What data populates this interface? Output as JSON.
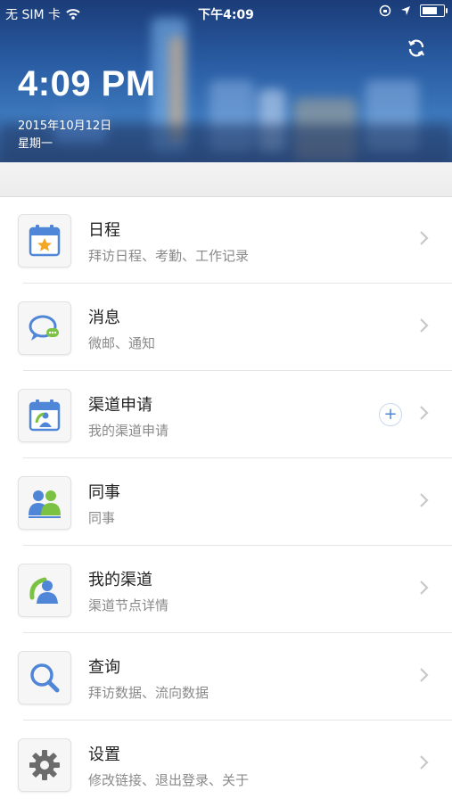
{
  "status_bar": {
    "carrier": "无 SIM 卡",
    "time": "下午4:09"
  },
  "header": {
    "clock": "4:09 PM",
    "date": "2015年10月12日",
    "weekday": "星期一"
  },
  "menu": [
    {
      "title": "日程",
      "subtitle": "拜访日程、考勤、工作记录",
      "icon": "calendar-star-icon"
    },
    {
      "title": "消息",
      "subtitle": "微邮、通知",
      "icon": "chat-bubble-icon"
    },
    {
      "title": "渠道申请",
      "subtitle": "我的渠道申请",
      "icon": "calendar-person-icon",
      "has_add": true
    },
    {
      "title": "同事",
      "subtitle": "同事",
      "icon": "colleagues-icon"
    },
    {
      "title": "我的渠道",
      "subtitle": "渠道节点详情",
      "icon": "channel-person-icon"
    },
    {
      "title": "查询",
      "subtitle": "拜访数据、流向数据",
      "icon": "search-icon"
    },
    {
      "title": "设置",
      "subtitle": "修改链接、退出登录、关于",
      "icon": "gear-icon"
    }
  ],
  "colors": {
    "accent_blue": "#4f86d8",
    "accent_green": "#7cc242"
  }
}
